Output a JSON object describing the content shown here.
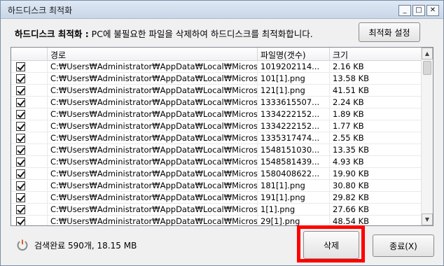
{
  "window": {
    "title": "하드디스크 최적화",
    "controls": {
      "minimize": "_",
      "maximize": "□",
      "close": "✕"
    }
  },
  "header": {
    "title_bold": "하드디스크 최적화 :",
    "description": " PC에 불필요한 파일을 삭제하여 하드디스크를 최적화합니다.",
    "settings_button": "최적화 설정"
  },
  "table": {
    "columns": [
      "",
      "경로",
      "파일명(갯수)",
      "크기"
    ],
    "rows": [
      {
        "checked": true,
        "path": "C:₩Users₩Administrator₩AppData₩Local₩Micros...",
        "name": "1019202114...",
        "size": "2.16 KB"
      },
      {
        "checked": true,
        "path": "C:₩Users₩Administrator₩AppData₩Local₩Micros...",
        "name": "101[1].png",
        "size": "13.58 KB"
      },
      {
        "checked": true,
        "path": "C:₩Users₩Administrator₩AppData₩Local₩Micros...",
        "name": "121[1].png",
        "size": "41.51 KB"
      },
      {
        "checked": true,
        "path": "C:₩Users₩Administrator₩AppData₩Local₩Micros...",
        "name": "1333615507...",
        "size": "2.24 KB"
      },
      {
        "checked": true,
        "path": "C:₩Users₩Administrator₩AppData₩Local₩Micros...",
        "name": "1334222152...",
        "size": "1.89 KB"
      },
      {
        "checked": true,
        "path": "C:₩Users₩Administrator₩AppData₩Local₩Micros...",
        "name": "1334222152...",
        "size": "1.77 KB"
      },
      {
        "checked": true,
        "path": "C:₩Users₩Administrator₩AppData₩Local₩Micros...",
        "name": "1335317474...",
        "size": "2.55 KB"
      },
      {
        "checked": true,
        "path": "C:₩Users₩Administrator₩AppData₩Local₩Micros...",
        "name": "1548151030...",
        "size": "13.35 KB"
      },
      {
        "checked": true,
        "path": "C:₩Users₩Administrator₩AppData₩Local₩Micros...",
        "name": "1548581439...",
        "size": "4.93 KB"
      },
      {
        "checked": true,
        "path": "C:₩Users₩Administrator₩AppData₩Local₩Micros...",
        "name": "1580408622...",
        "size": "19.90 KB"
      },
      {
        "checked": true,
        "path": "C:₩Users₩Administrator₩AppData₩Local₩Micros...",
        "name": "181[1].png",
        "size": "30.80 KB"
      },
      {
        "checked": true,
        "path": "C:₩Users₩Administrator₩AppData₩Local₩Micros...",
        "name": "191[1].png",
        "size": "29.82 KB"
      },
      {
        "checked": true,
        "path": "C:₩Users₩Administrator₩AppData₩Local₩Micros...",
        "name": "1[1].png",
        "size": "27.66 KB"
      },
      {
        "checked": true,
        "path": "C:₩Users₩Administrator₩AppData₩Local₩Micros...",
        "name": "29[1].png",
        "size": "48.54 KB"
      }
    ]
  },
  "status": {
    "icon": "power-icon",
    "text": "검색완료 590개, 18.15 MB"
  },
  "buttons": {
    "delete": "삭제",
    "exit": "종료(X)"
  },
  "colors": {
    "highlight": "#ff0000"
  }
}
